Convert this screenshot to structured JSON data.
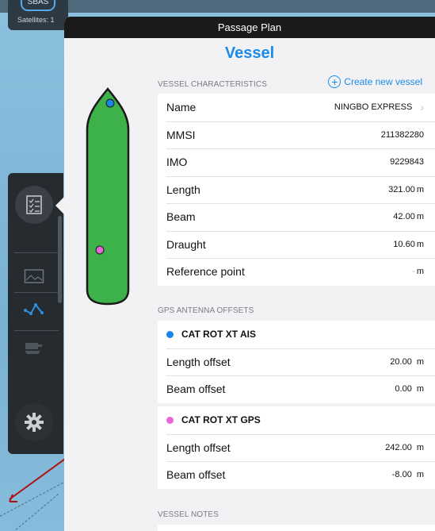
{
  "status": {
    "sbas_label": "SBAS",
    "satellites_label": "Satellites: 1"
  },
  "modal": {
    "title": "Passage Plan",
    "heading": "Vessel"
  },
  "vessel_characteristics": {
    "header": "VESSEL CHARACTERISTICS",
    "create_label": "Create new vessel",
    "rows": [
      {
        "label": "Name",
        "value": "NINGBO EXPRESS",
        "unit": ""
      },
      {
        "label": "MMSI",
        "value": "211382280",
        "unit": ""
      },
      {
        "label": "IMO",
        "value": "9229843",
        "unit": ""
      },
      {
        "label": "Length",
        "value": "321.00",
        "unit": "m"
      },
      {
        "label": "Beam",
        "value": "42.00",
        "unit": "m"
      },
      {
        "label": "Draught",
        "value": "10.60",
        "unit": "m"
      },
      {
        "label": "Reference point",
        "value": "-",
        "unit": "m"
      }
    ]
  },
  "gps_antenna_offsets": {
    "header": "GPS ANTENNA OFFSETS",
    "antennas": [
      {
        "name": "CAT ROT XT AIS",
        "dot_color": "#1a87e6",
        "length_label": "Length offset",
        "length_value": "20.00",
        "length_unit": "m",
        "beam_label": "Beam offset",
        "beam_value": "0.00",
        "beam_unit": "m"
      },
      {
        "name": "CAT ROT XT GPS",
        "dot_color": "#e667d8",
        "length_label": "Length offset",
        "length_value": "242.00",
        "length_unit": "m",
        "beam_label": "Beam offset",
        "beam_value": "-8.00",
        "beam_unit": "m"
      }
    ]
  },
  "vessel_notes": {
    "header": "VESSEL NOTES"
  },
  "colors": {
    "accent": "#1a8bec",
    "hull": "#3db14a",
    "titlebar": "#1a1a1a"
  },
  "icons": {
    "toolbar": [
      "checklist-icon",
      "map-image-icon",
      "route-icon",
      "vessel-icon",
      "gear-icon"
    ]
  }
}
